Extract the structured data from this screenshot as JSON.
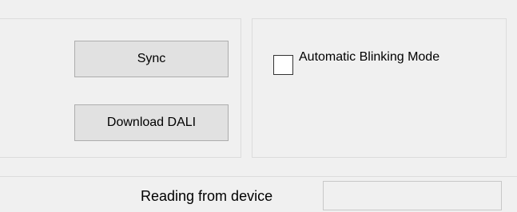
{
  "controls": {
    "sync_label": "Sync",
    "download_label": "Download DALI"
  },
  "options": {
    "automatic_blinking_label": "Automatic Blinking Mode",
    "automatic_blinking_checked": false
  },
  "status": {
    "label": "Reading from device",
    "value": ""
  }
}
